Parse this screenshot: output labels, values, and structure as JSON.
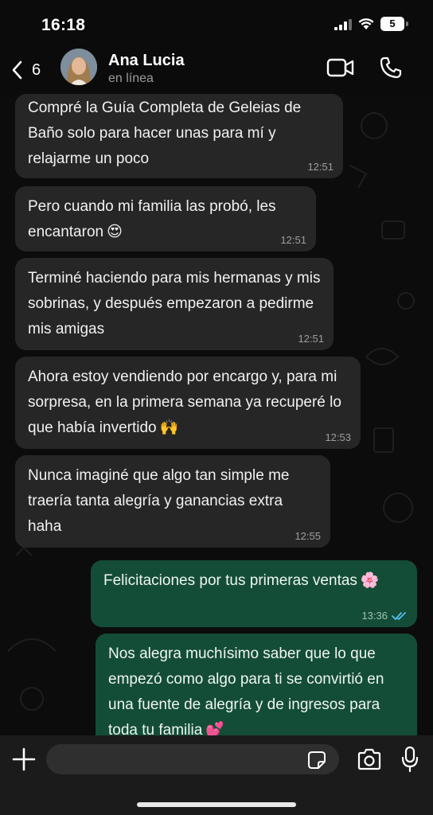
{
  "status_bar": {
    "time": "16:18",
    "battery": "5",
    "icons": [
      "signal-icon",
      "wifi-icon",
      "battery-icon"
    ]
  },
  "header": {
    "back_count": "6",
    "contact_name": "Ana Lucia",
    "contact_status": "en línea",
    "icons": [
      "chevron-left-icon",
      "video-call-icon",
      "phone-icon"
    ]
  },
  "messages": [
    {
      "direction": "in",
      "text": "Compré la Guía Completa de Geleias de Baño solo para hacer unas para mí y relajarme un poco",
      "time": "12:51"
    },
    {
      "direction": "in",
      "text": "Pero cuando mi familia las probó, les encantaron",
      "emoji": "😍",
      "time": "12:51"
    },
    {
      "direction": "in",
      "text": "Terminé haciendo para mis hermanas y mis sobrinas, y después empezaron a pedirme mis amigas",
      "time": "12:51"
    },
    {
      "direction": "in",
      "text": "Ahora estoy vendiendo por encargo y, para mi sorpresa, en la primera semana ya recuperé lo que había invertido",
      "emoji": "🙌",
      "time": "12:53"
    },
    {
      "direction": "in",
      "text": "Nunca imaginé que algo tan simple me traería tanta alegría y ganancias extra haha",
      "time": "12:55"
    },
    {
      "direction": "out",
      "text": "Felicitaciones por tus primeras ventas",
      "emoji": "🌸",
      "time": "13:36",
      "status": "read"
    },
    {
      "direction": "out",
      "text": "Nos alegra muchísimo saber que lo que empezó como algo para ti se convirtió en una fuente de alegría y de ingresos para toda tu familia",
      "emoji": "💕",
      "time": ""
    }
  ],
  "composer": {
    "placeholder": "",
    "icons": [
      "plus-icon",
      "sticker-icon",
      "camera-icon",
      "microphone-icon"
    ]
  },
  "colors": {
    "background": "#0b0b0b",
    "incoming_bubble": "#262626",
    "outgoing_bubble": "#144d37",
    "read_ticks": "#53bdeb"
  }
}
